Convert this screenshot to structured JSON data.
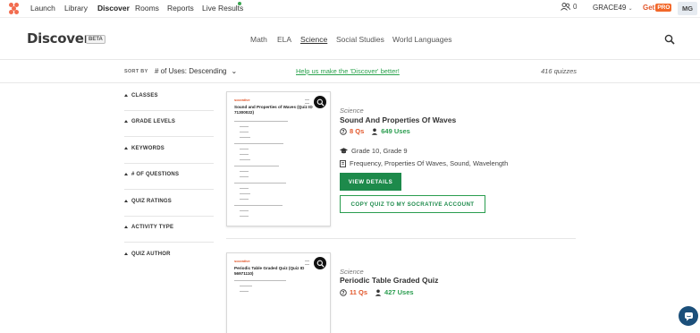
{
  "nav": {
    "items": [
      "Launch",
      "Library",
      "Discover",
      "Rooms",
      "Reports",
      "Live Results"
    ],
    "active": "Discover",
    "people_count": "0",
    "room": "GRACE49",
    "get_label": "Get",
    "pro_label": "PRO",
    "avatar": "MG",
    "brand_color": "#f26c4f",
    "accent_green": "#2a9d4f"
  },
  "header": {
    "title": "Discover",
    "badge": "BETA",
    "subjects": [
      "Math",
      "ELA",
      "Science",
      "Social Studies",
      "World Languages"
    ],
    "active_subject": "Science"
  },
  "sort": {
    "label": "SORT BY",
    "value": "# of Uses: Descending",
    "help_link": "Help us make the 'Discover' better!",
    "count": "416 quizzes"
  },
  "filters": [
    "CLASSES",
    "GRADE LEVELS",
    "KEYWORDS",
    "# OF QUESTIONS",
    "QUIZ RATINGS",
    "ACTIVITY TYPE",
    "QUIZ AUTHOR"
  ],
  "quizzes": [
    {
      "subject": "Science",
      "name": "Sound And Properties Of Waves",
      "questions": "8 Qs",
      "uses": "649 Uses",
      "grades": "Grade 10, Grade 9",
      "tags": "Frequency, Properties Of Waves, Sound, Wavelength",
      "thumb_brand": "socrative",
      "thumb_title": "Sound and Properties of Waves (Quiz ID 71300022)",
      "view_label": "VIEW DETAILS",
      "copy_label": "COPY QUIZ TO MY SOCRATIVE ACCOUNT"
    },
    {
      "subject": "Science",
      "name": "Periodic Table Graded Quiz",
      "questions": "11 Qs",
      "uses": "427 Uses",
      "thumb_brand": "socrative",
      "thumb_title": "Periodic Table Graded Quiz (Quiz ID 56971110)"
    }
  ]
}
